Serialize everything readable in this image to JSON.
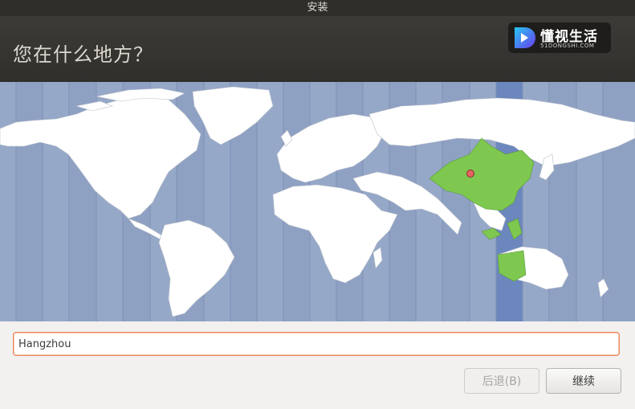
{
  "window": {
    "title": "安装"
  },
  "page": {
    "heading": "您在什么地方？"
  },
  "watermark": {
    "name": "懂视生活",
    "domain": "51DONGSHI.COM"
  },
  "map": {
    "selected_timezone_color": "#6c87bd",
    "highlight_region_color": "#7ec850",
    "ocean_color": "#8fa1c3",
    "land_color": "#ffffff",
    "marker_icon": "location-pin-icon"
  },
  "location": {
    "value": "Hangzhou"
  },
  "buttons": {
    "back_label": "后退(B)",
    "continue_label": "继续"
  }
}
